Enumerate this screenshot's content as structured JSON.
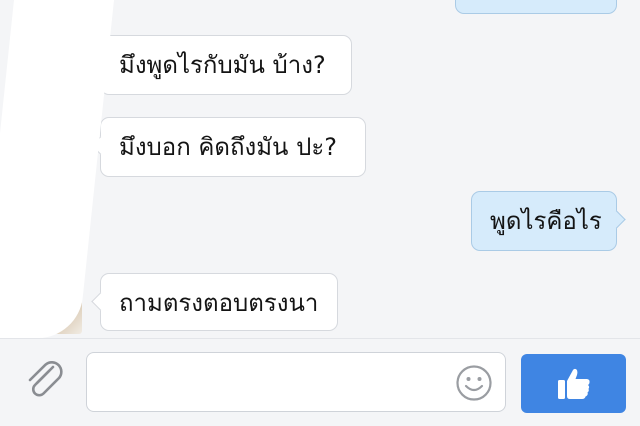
{
  "messages": [
    {
      "direction": "incoming",
      "text": "มึงพูดไรกับมัน บ้าง?"
    },
    {
      "direction": "incoming",
      "text": "มึงบอก คิดถึงมัน ปะ?"
    },
    {
      "direction": "outgoing",
      "text": "พูดไรคือไร"
    },
    {
      "direction": "incoming",
      "text": "ถามตรงตอบตรงนา"
    }
  ],
  "composer": {
    "input_value": "",
    "input_placeholder": ""
  },
  "icons": {
    "attach": "paperclip-icon",
    "emoji": "smiley-icon",
    "send": "thumbs-up-icon"
  },
  "colors": {
    "incoming_bubble": "#ffffff",
    "outgoing_bubble": "#d6ebfb",
    "like_button": "#3f85e3",
    "background": "#f4f5f7"
  }
}
